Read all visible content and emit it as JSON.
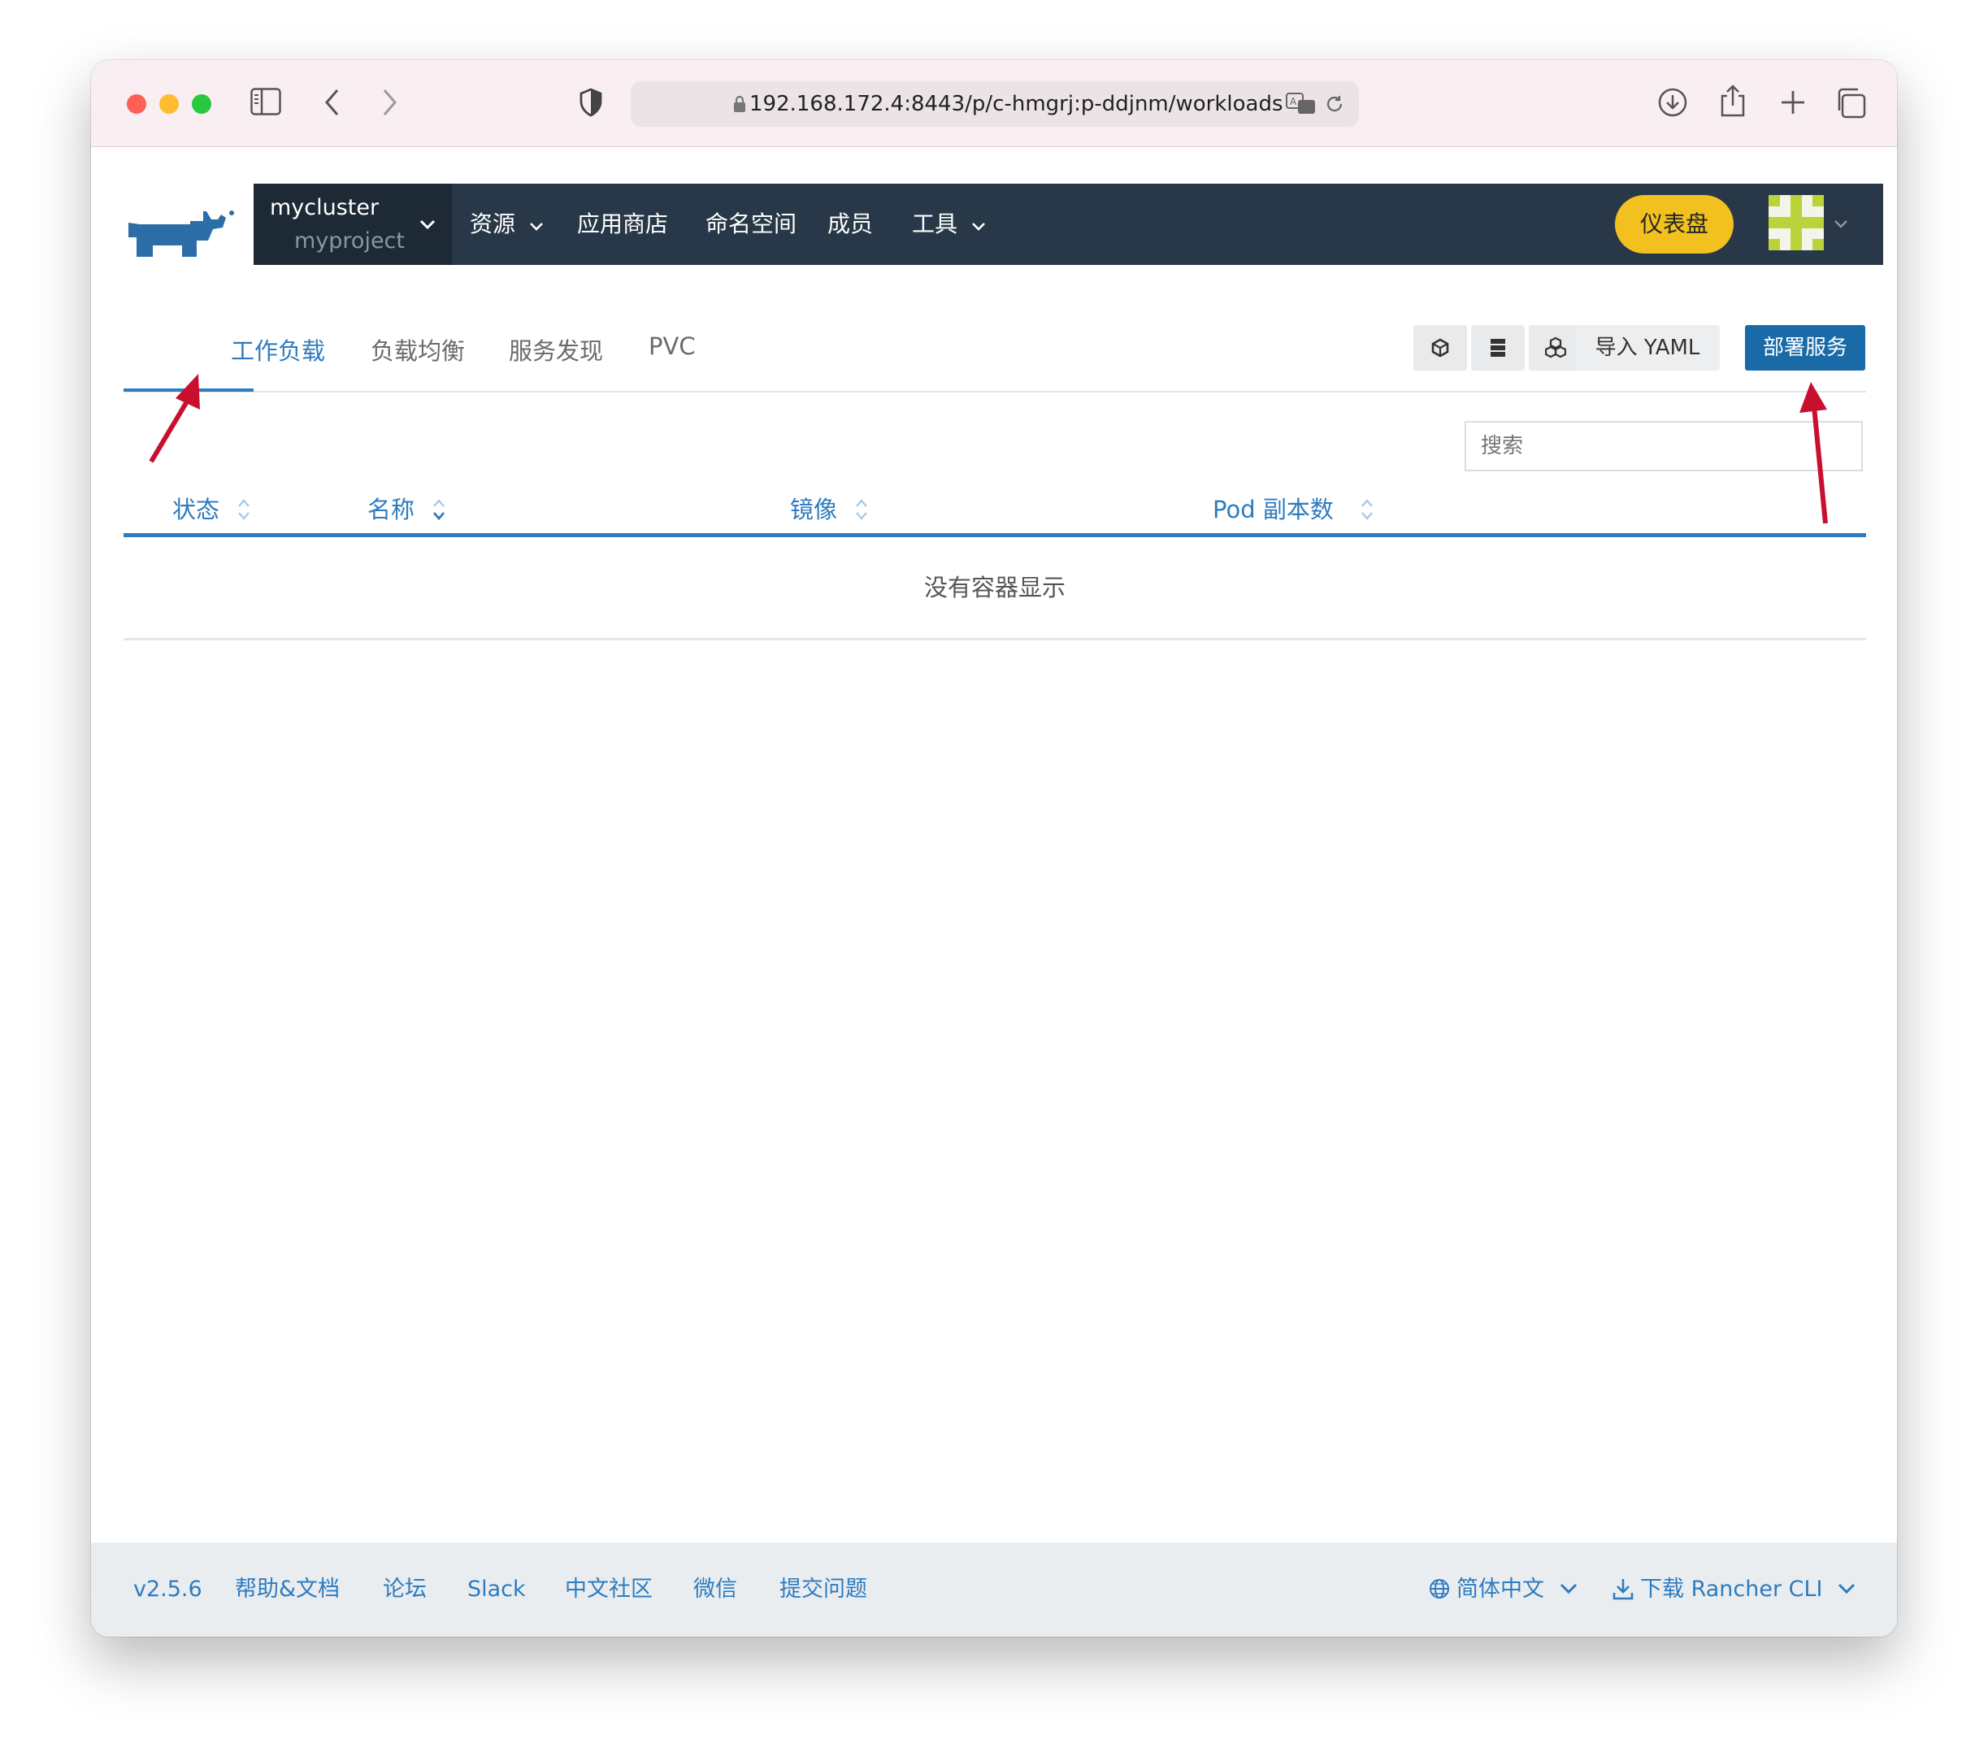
{
  "browser": {
    "url": "192.168.172.4:8443/p/c-hmgrj:p-ddjnm/workloads"
  },
  "nav": {
    "cluster": "mycluster",
    "project": "myproject",
    "items": [
      "资源",
      "应用商店",
      "命名空间",
      "成员",
      "工具"
    ],
    "dashboard": "仪表盘"
  },
  "tabs": [
    "工作负载",
    "负载均衡",
    "服务发现",
    "PVC"
  ],
  "actions": {
    "import_yaml": "导入 YAML",
    "deploy": "部署服务"
  },
  "search": {
    "placeholder": "搜索"
  },
  "table": {
    "headers": [
      "状态",
      "名称",
      "镜像",
      "Pod 副本数"
    ],
    "empty": "没有容器显示"
  },
  "footer": {
    "version": "v2.5.6",
    "links": [
      "帮助&文档",
      "论坛",
      "Slack",
      "中文社区",
      "微信",
      "提交问题"
    ],
    "language": "简体中文",
    "download": "下载 Rancher CLI"
  },
  "colors": {
    "accent": "#2d7cc0",
    "nav_bg": "#283848",
    "dashboard_btn": "#f2c01f",
    "deploy_btn": "#1a6aa8",
    "annotation_arrow": "#c8102e"
  }
}
